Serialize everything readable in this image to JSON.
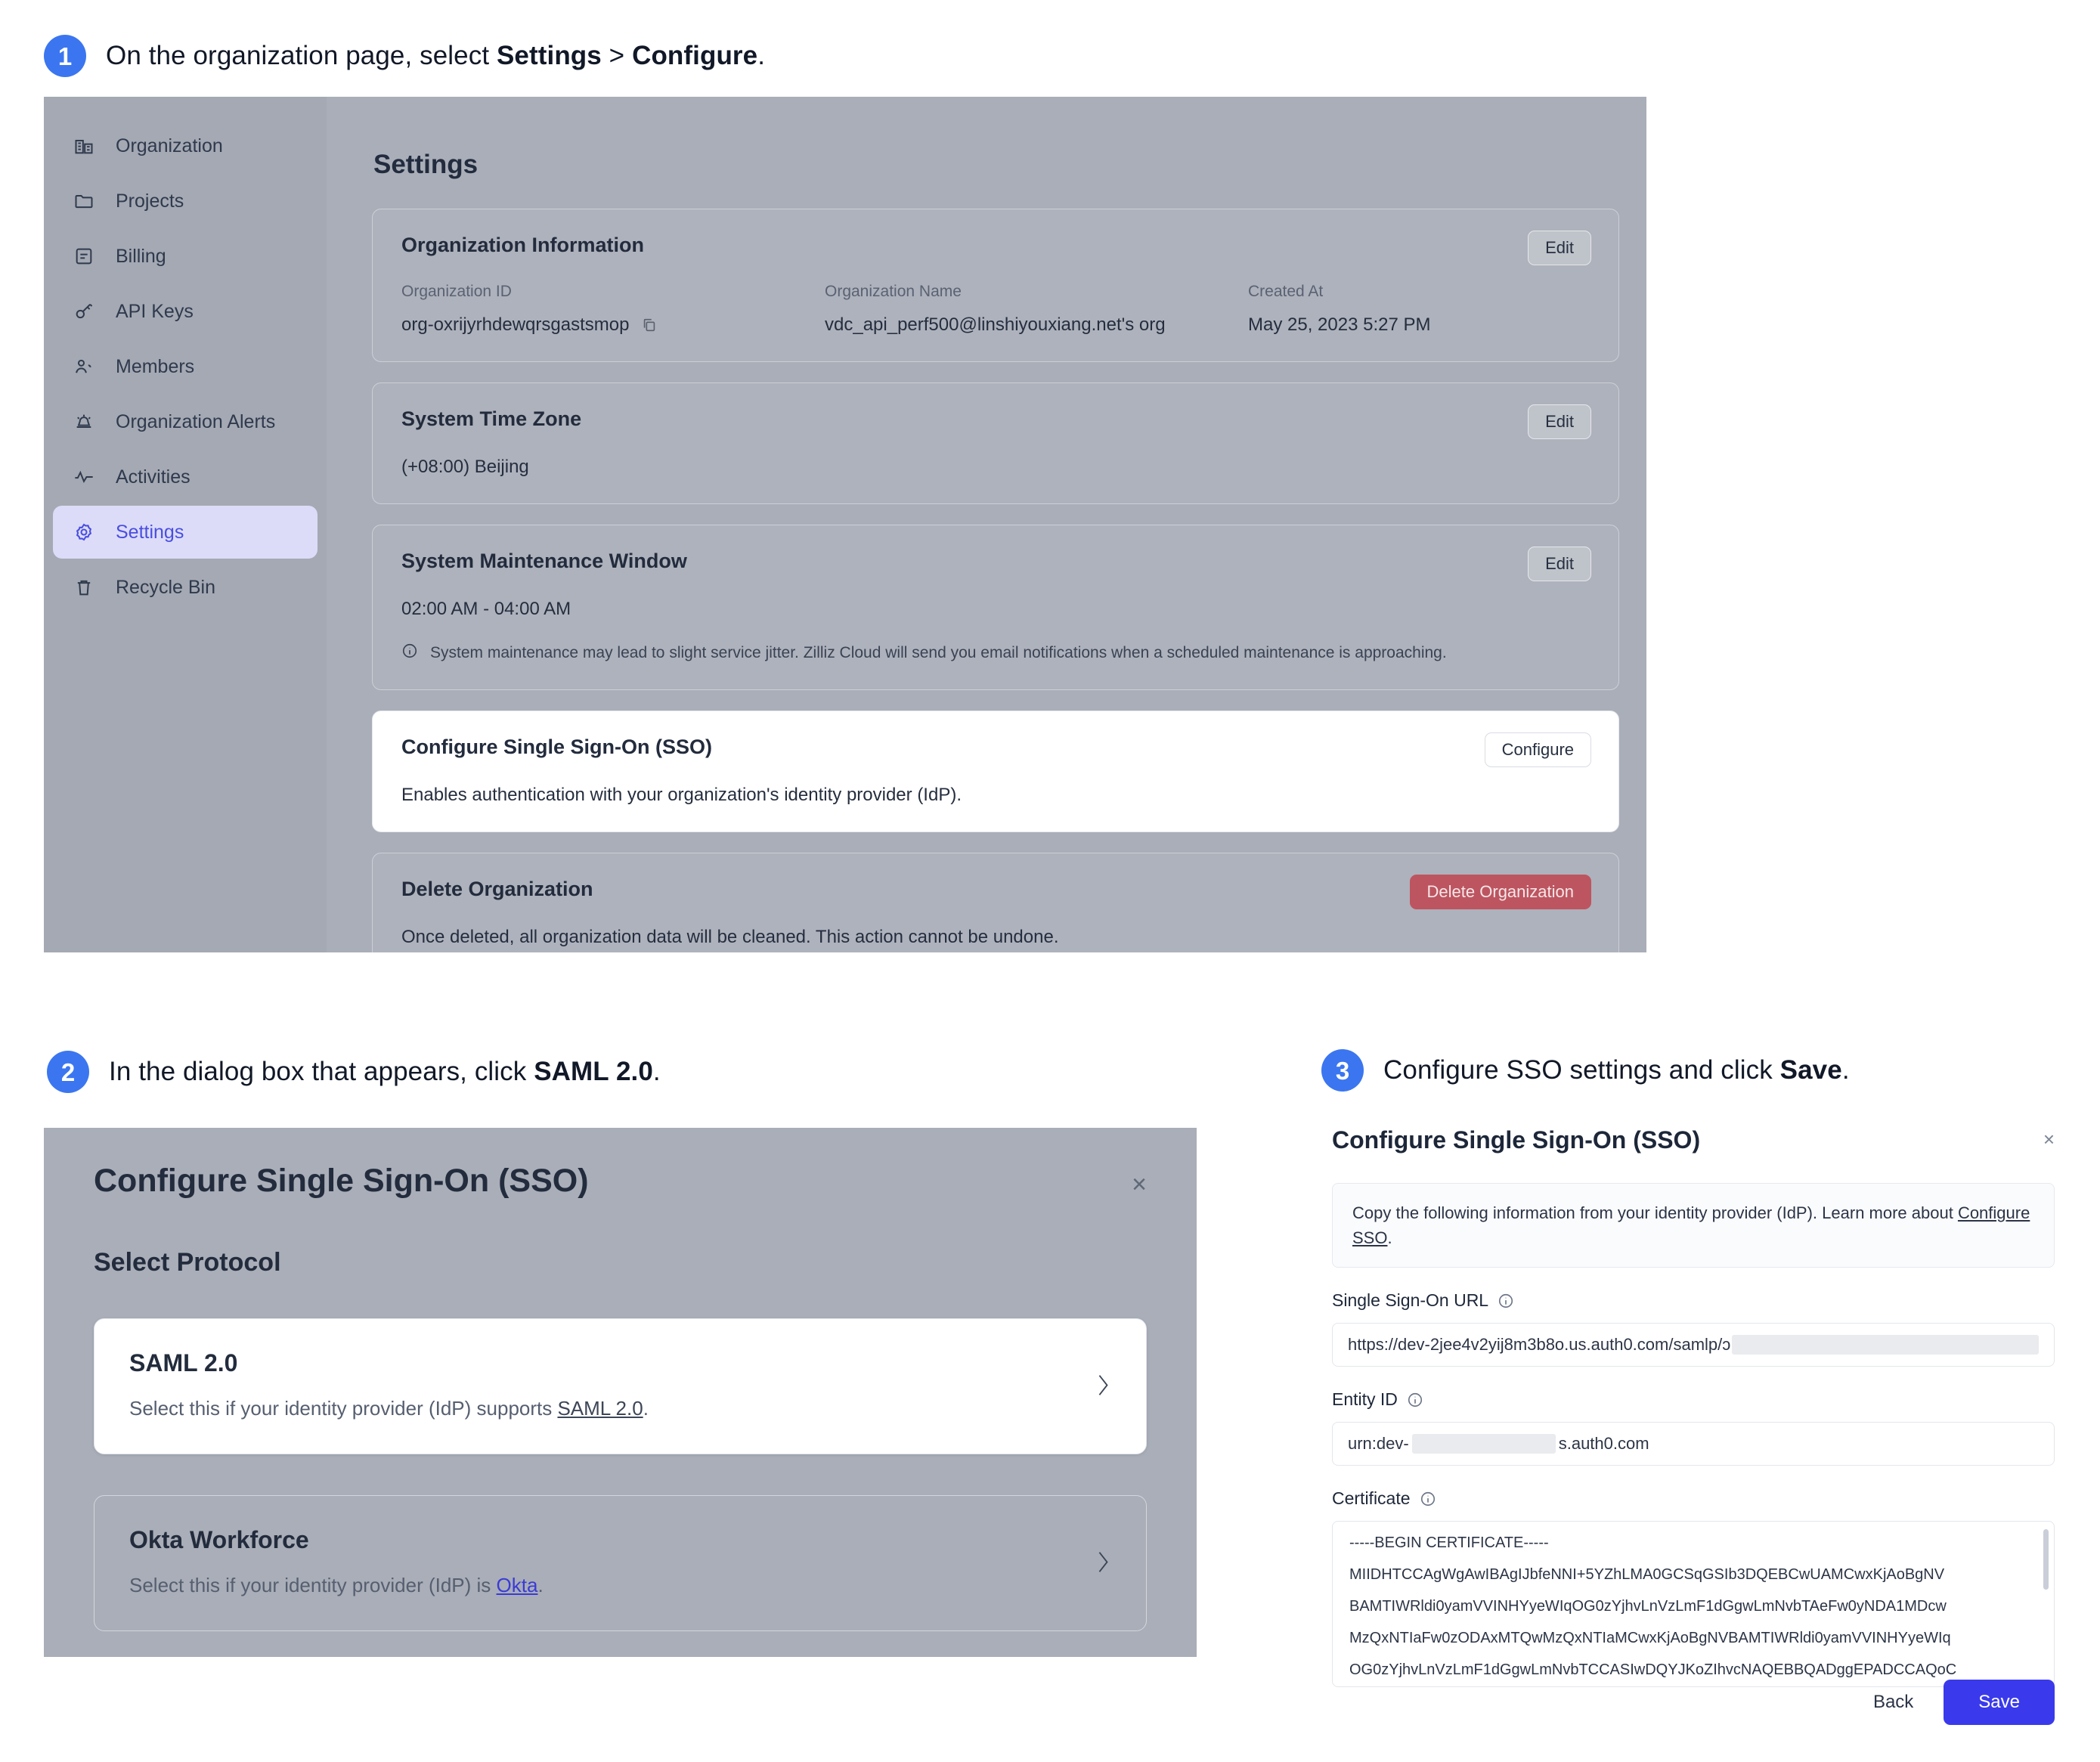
{
  "steps": [
    {
      "num": "1",
      "pre": "On the organization page, select ",
      "b1": "Settings",
      "mid": " > ",
      "b2": "Configure",
      "post": "."
    },
    {
      "num": "2",
      "pre": "In the dialog box that appears, click ",
      "b1": "SAML 2.0",
      "post": "."
    },
    {
      "num": "3",
      "pre": "Configure SSO settings and click ",
      "b1": "Save",
      "post": "."
    }
  ],
  "colors": {
    "accent_blue": "#3b76f0",
    "save_blue": "#3a3aec",
    "active_nav_bg": "#dcdcf8",
    "active_nav_fg": "#4a4ee0",
    "danger_red": "#bd5560"
  },
  "panel1": {
    "sidebar": [
      {
        "label": "Organization",
        "icon": "building-icon"
      },
      {
        "label": "Projects",
        "icon": "folder-icon"
      },
      {
        "label": "Billing",
        "icon": "receipt-icon"
      },
      {
        "label": "API Keys",
        "icon": "key-icon"
      },
      {
        "label": "Members",
        "icon": "users-icon"
      },
      {
        "label": "Organization Alerts",
        "icon": "alarm-icon"
      },
      {
        "label": "Activities",
        "icon": "activity-icon"
      },
      {
        "label": "Settings",
        "icon": "gear-icon"
      },
      {
        "label": "Recycle Bin",
        "icon": "trash-icon"
      }
    ],
    "page_title": "Settings",
    "org_info": {
      "title": "Organization Information",
      "edit_label": "Edit",
      "fields": [
        {
          "label": "Organization ID",
          "value": "org-oxrijyrhdewqrsgastsmop"
        },
        {
          "label": "Organization Name",
          "value": "vdc_api_perf500@linshiyouxiang.net's org"
        },
        {
          "label": "Created At",
          "value": "May 25, 2023 5:27 PM"
        }
      ]
    },
    "time_zone": {
      "title": "System Time Zone",
      "edit_label": "Edit",
      "value": "(+08:00) Beijing"
    },
    "maintenance": {
      "title": "System Maintenance Window",
      "edit_label": "Edit",
      "value": "02:00 AM - 04:00 AM",
      "note": "System maintenance may lead to slight service jitter. Zilliz Cloud will send you email notifications when a scheduled maintenance is approaching."
    },
    "sso": {
      "title": "Configure Single Sign-On (SSO)",
      "button_label": "Configure",
      "description": "Enables authentication with your organization's identity provider (IdP)."
    },
    "delete_org": {
      "title": "Delete Organization",
      "button_label": "Delete Organization",
      "description": "Once deleted, all organization data will be cleaned. This action cannot be undone."
    }
  },
  "panel2": {
    "title": "Configure Single Sign-On (SSO)",
    "close_label": "×",
    "subtitle": "Select Protocol",
    "options": [
      {
        "name": "SAML 2.0",
        "desc_pre": "Select this if your identity provider (IdP) supports ",
        "desc_link": "SAML 2.0",
        "desc_post": ".",
        "selected": true
      },
      {
        "name": "Okta Workforce",
        "desc_pre": "Select this if your identity provider (IdP) is ",
        "desc_link": "Okta",
        "desc_post": ".",
        "selected": false
      }
    ]
  },
  "panel3": {
    "title": "Configure Single Sign-On (SSO)",
    "close_label": "×",
    "notice_pre": "Copy the following information from your identity provider (IdP). Learn more about ",
    "notice_link": "Configure SSO",
    "notice_post": ".",
    "sso_url": {
      "label": "Single Sign-On URL",
      "value": "https://dev-2jee4v2yij8m3b8o.us.auth0.com/samlp/ɔ"
    },
    "entity_id": {
      "label": "Entity ID",
      "value_pre": "urn:dev-",
      "value_post": "s.auth0.com"
    },
    "certificate": {
      "label": "Certificate",
      "lines": [
        "-----BEGIN CERTIFICATE-----",
        "MIIDHTCCAgWgAwIBAgIJbfeNNI+5YZhLMA0GCSqGSIb3DQEBCwUAMCwxKjAoBgNV",
        "BAMTIWRldi0yamVVINHYyeWIqOG0zYjhvLnVzLmF1dGgwLmNvbTAeFw0yNDA1MDcw",
        "MzQxNTIaFw0zODAxMTQwMzQxNTIaMCwxKjAoBgNVBAMTIWRldi0yamVVINHYyeWIq",
        "OG0zYjhvLnVzLmF1dGgwLmNvbTCCASIwDQYJKoZIhvcNAQEBBQADggEPADCCAQoC"
      ]
    },
    "back_label": "Back",
    "save_label": "Save"
  }
}
